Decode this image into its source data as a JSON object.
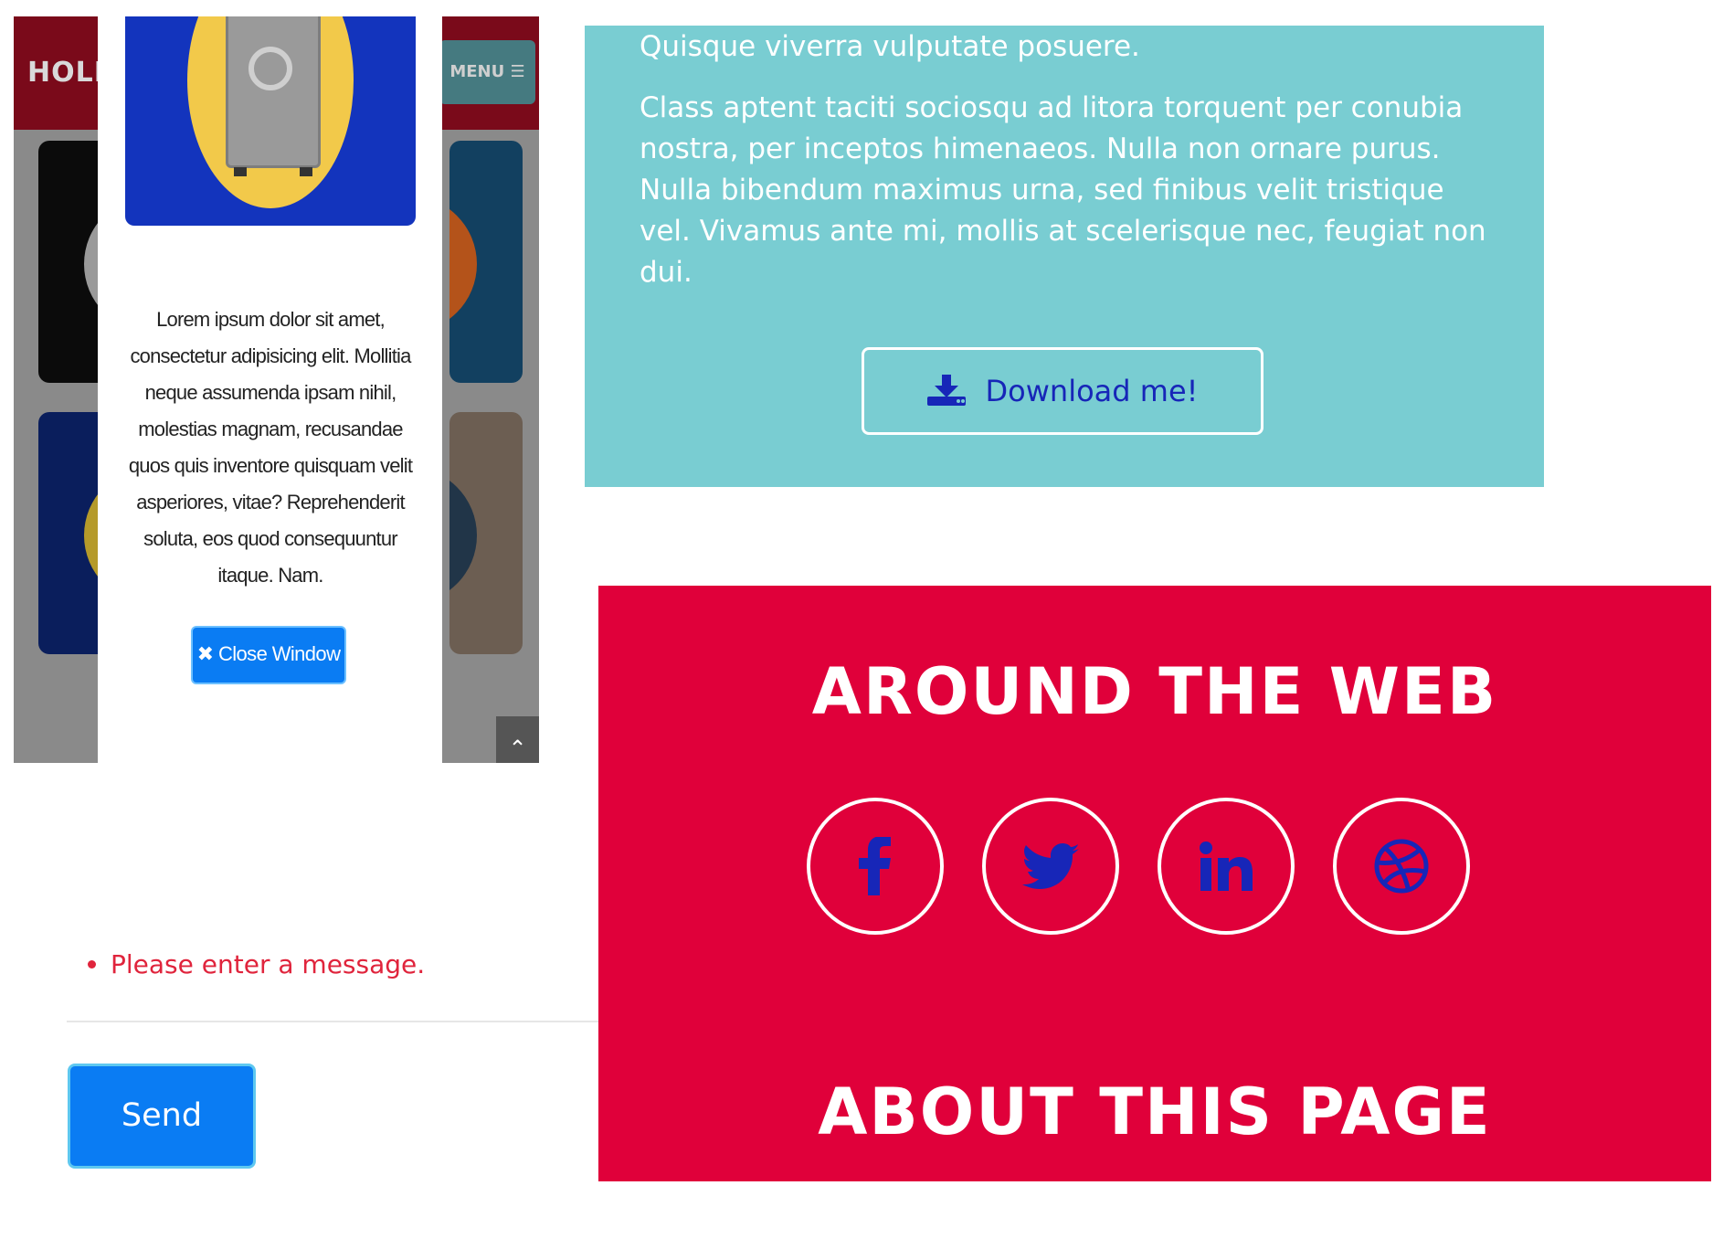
{
  "phone": {
    "brand": "HOLBE",
    "menu_label": "MENU ☰",
    "scroll_top_glyph": "⌃"
  },
  "modal": {
    "body_text": "Lorem ipsum dolor sit amet, consectetur adipisicing elit. Mollitia neque assumenda ipsam nihil, molestias magnam, recusandae quos quis inventore quisquam velit asperiores, vitae? Reprehenderit soluta, eos quod consequuntur itaque. Nam.",
    "close_label": "✖ Close Window",
    "image_icon": "safe-icon"
  },
  "info": {
    "paragraph1": "Quisque viverra vulputate posuere.",
    "paragraph2": "Class aptent taciti sociosqu ad litora torquent per conubia nostra, per inceptos himenaeos. Nulla non ornare purus. Nulla bibendum maximus urna, sed finibus velit tristique vel. Vivamus ante mi, mollis at scelerisque nec, feugiat non dui.",
    "download_label": "Download me!",
    "download_icon": "download-icon"
  },
  "form": {
    "errors": [
      "Please enter a message."
    ],
    "send_label": "Send"
  },
  "footer": {
    "around_heading": "AROUND THE WEB",
    "about_heading": "ABOUT THIS PAGE",
    "social_icons": [
      "facebook-icon",
      "twitter-icon",
      "linkedin-icon",
      "dribbble-icon"
    ]
  },
  "colors": {
    "teal": "#79cdd2",
    "red": "#e0003a",
    "blue_button": "#0a7cf3",
    "icon_blue": "#1726b8",
    "error_red": "#e0243c"
  }
}
